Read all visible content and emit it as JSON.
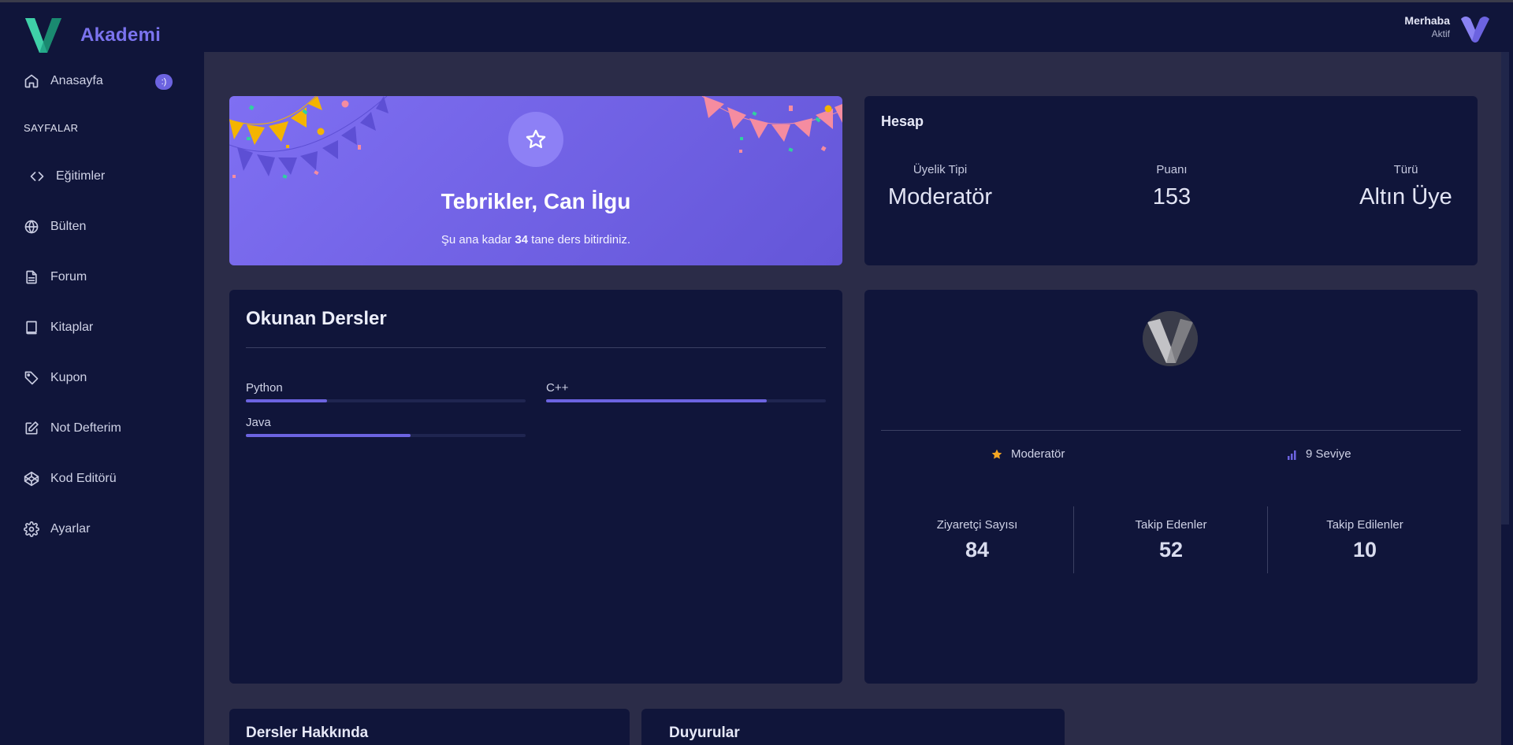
{
  "brand": {
    "name": "Akademi",
    "color": "#7b73ee"
  },
  "sidebar": {
    "home": {
      "label": "Anasayfa",
      "badge": ":)"
    },
    "section_label": "SAYFALAR",
    "items": [
      {
        "label": "Eğitimler",
        "icon": "code-icon"
      },
      {
        "label": "Bülten",
        "icon": "globe-icon"
      },
      {
        "label": "Forum",
        "icon": "document-icon"
      },
      {
        "label": "Kitaplar",
        "icon": "book-icon"
      },
      {
        "label": "Kupon",
        "icon": "tag-icon"
      },
      {
        "label": "Not Defterim",
        "icon": "edit-icon"
      },
      {
        "label": "Kod Editörü",
        "icon": "codepen-icon"
      },
      {
        "label": "Ayarlar",
        "icon": "gear-icon"
      }
    ]
  },
  "header": {
    "greeting": "Merhaba",
    "status": "Aktif"
  },
  "congrats": {
    "title": "Tebrikler, Can İlgu",
    "sub_before": "Şu ana kadar",
    "count": "34",
    "sub_after": "tane ders bitirdiniz."
  },
  "account": {
    "title": "Hesap",
    "stats": [
      {
        "label": "Üyelik Tipi",
        "value": "Moderatör"
      },
      {
        "label": "Puanı",
        "value": "153"
      },
      {
        "label": "Türü",
        "value": "Altın Üye"
      }
    ]
  },
  "courses": {
    "title": "Okunan Dersler",
    "items": [
      {
        "label": "Python",
        "progress": 0.29
      },
      {
        "label": "C++",
        "progress": 0.79
      },
      {
        "label": "Java",
        "progress": 0.59
      }
    ]
  },
  "profile": {
    "role": "Moderatör",
    "level": "9 Seviye",
    "counters": [
      {
        "label": "Ziyaretçi Sayısı",
        "value": "84"
      },
      {
        "label": "Takip Edenler",
        "value": "52"
      },
      {
        "label": "Takip Edilenler",
        "value": "10"
      }
    ]
  },
  "bottom": {
    "left_title": "Dersler Hakkında",
    "right_title": "Duyurular"
  },
  "colors": {
    "accent": "#6c63e0",
    "sidebar_bg": "#10153a",
    "page_bg": "#2b2c48",
    "star": "#f5a623"
  }
}
